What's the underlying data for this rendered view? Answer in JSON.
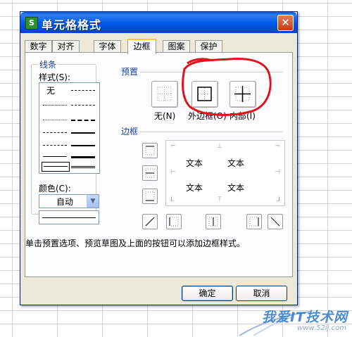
{
  "dialog": {
    "app_icon": "S",
    "title": "单元格格式",
    "close_glyph": "✕"
  },
  "tabs": [
    "数字",
    "对齐",
    "字体",
    "边框",
    "图案",
    "保护"
  ],
  "active_tab": "边框",
  "line_group": {
    "label": "线条",
    "style_label": "样式(S):",
    "none_label": "无",
    "color_label": "颜色(C):",
    "color_value": "自动"
  },
  "presets": {
    "label": "预置",
    "none": "无(N)",
    "outline": "外边框(O)",
    "inside": "内部(I)"
  },
  "border_group": {
    "label": "边框",
    "preview_text": [
      "文本",
      "文本",
      "文本",
      "文本"
    ]
  },
  "hint": "单击预置选项、预览草图及上面的按钮可以添加边框样式。",
  "buttons": {
    "ok": "确定",
    "cancel": "取消"
  },
  "watermark": {
    "text": "我爱IT技术网",
    "url": "www.52ij.com"
  },
  "colors": {
    "titlebar": "#0058e6",
    "dialog_bg": "#ece9d8",
    "annotation": "#e0121b",
    "group_label": "#1f3f9f"
  }
}
